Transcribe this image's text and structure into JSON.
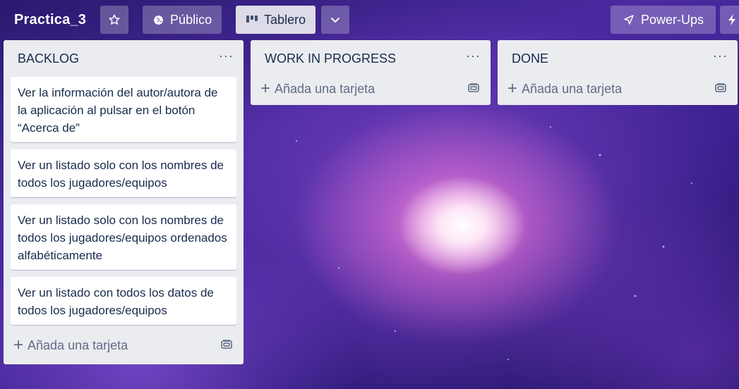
{
  "board": {
    "title": "Practica_3",
    "visibility_label": "Público",
    "view_label": "Tablero",
    "powerups_label": "Power-Ups"
  },
  "icons": {
    "star": "star-icon",
    "visibility": "globe-icon",
    "view": "board-icon",
    "chevron": "chevron-down-icon",
    "powerups": "rocket-icon",
    "automation": "bolt-icon",
    "template": "card-template-icon"
  },
  "lists": [
    {
      "title": "BACKLOG",
      "menu": "···",
      "cards": [
        "Ver la información del autor/autora de la aplicación al pulsar en el botón “Acerca de”",
        "Ver un listado solo con los nombres de todos los jugadores/equipos",
        "Ver un listado solo con los nombres de todos los jugadores/equipos ordenados alfabéticamente",
        "Ver un listado con todos los datos de todos los jugadores/equipos"
      ],
      "add_label": "Añada una tarjeta"
    },
    {
      "title": "WORK IN PROGRESS",
      "menu": "···",
      "cards": [],
      "add_label": "Añada una tarjeta"
    },
    {
      "title": "DONE",
      "menu": "···",
      "cards": [],
      "add_label": "Añada una tarjeta"
    }
  ],
  "colors": {
    "list_bg": "#ebecf0",
    "card_text": "#172b4d",
    "muted_text": "#5e6c84"
  }
}
